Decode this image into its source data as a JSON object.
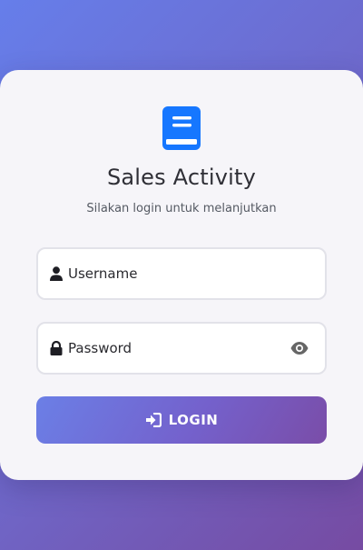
{
  "app": {
    "title": "Sales Activity",
    "subtitle": "Silakan login untuk melanjutkan"
  },
  "form": {
    "username": {
      "placeholder": "Username",
      "value": "",
      "icon": "user-icon"
    },
    "password": {
      "placeholder": "Password",
      "value": "",
      "icon": "lock-icon",
      "toggle_icon": "eye-icon"
    },
    "login_label": "LOGIN",
    "login_icon": "sign-in-icon"
  },
  "colors": {
    "brand_blue": "#1677ff",
    "gradient_start": "#667eea",
    "gradient_end": "#764ba2",
    "card_background": "#f6f5f9"
  }
}
